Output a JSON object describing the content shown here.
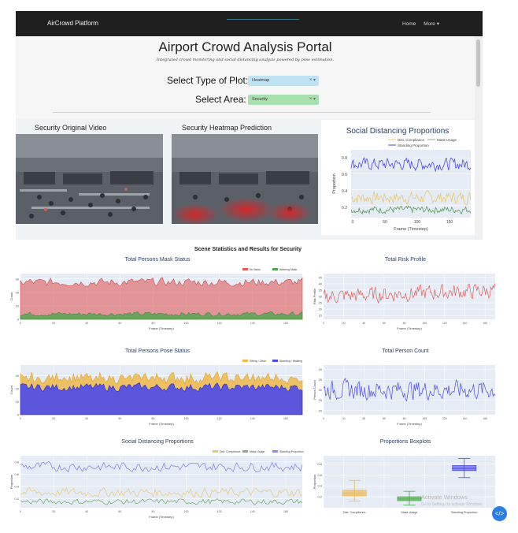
{
  "navbar": {
    "brand": "AirCrowd Platform",
    "links": [
      "Home",
      "More ▾"
    ]
  },
  "header": {
    "title": "Airport Crowd Analysis Portal",
    "subtitle": "Integrated crowd monitoring and social distancing analysis powered by pose estimation.",
    "plot_label": "Select Type of Plot:",
    "plot_value": "Heatmap",
    "area_label": "Select Area:",
    "area_value": "Security",
    "clear_glyph": "× ▾"
  },
  "videos": {
    "original_title": "Security Original Video",
    "heatmap_title": "Security Heatmap Prediction"
  },
  "colors": {
    "red": "#e05c5c",
    "green": "#4fa64f",
    "orange": "#f0b84a",
    "blue": "#4a4ae8",
    "yellow": "#e8c870",
    "grid": "#e5ecf6"
  },
  "section_heading": "Scene Statistics and Results for Security",
  "charts": {
    "top_sdp": {
      "title": "Social Distancing Proportions",
      "legend": [
        "Dist. Compliance",
        "Mask Usage",
        "Standing Proportion"
      ],
      "xlabel": "Frame (Timestep)",
      "ylabel": "Proportion",
      "xticks": [
        "0",
        "50",
        "100",
        "150"
      ],
      "yticks": [
        "0.2",
        "0.4",
        "0.6",
        "0.8"
      ]
    },
    "mask": {
      "title": "Total Persons Mask Status",
      "legend": [
        "No Mask",
        "Wearing Mask"
      ],
      "xlabel": "Frame (Timestep)",
      "ylabel": "Count"
    },
    "risk": {
      "title": "Total Risk Profile",
      "xlabel": "Frame (Timestep)",
      "ylabel": "Risk Profile"
    },
    "pose": {
      "title": "Total Persons Pose Status",
      "legend": [
        "Sitting / Other",
        "Standing / Walking"
      ],
      "xlabel": "Frame (Timestep)",
      "ylabel": "Count"
    },
    "count": {
      "title": "Total Person Count",
      "xlabel": "Frame (Timestep)",
      "ylabel": "Person Count"
    },
    "sdp": {
      "title": "Social Distancing Proportions",
      "legend": [
        "Dist. Compliance",
        "Mask Usage",
        "Standing Proportion"
      ],
      "xlabel": "Frame (Timestep)",
      "ylabel": "Proportion"
    },
    "box": {
      "title": "Proportions Boxplots",
      "categories": [
        "Dist. Compliance",
        "Mask Usage",
        "Standing Proportion"
      ],
      "ylabel": "Proportion"
    }
  },
  "chart_data": [
    {
      "type": "line",
      "title": "Social Distancing Proportions",
      "xlabel": "Frame (Timestep)",
      "ylabel": "Proportion",
      "xlim": [
        0,
        180
      ],
      "ylim": [
        0.05,
        0.9
      ],
      "series": [
        {
          "name": "Dist. Compliance",
          "mean": 0.3
        },
        {
          "name": "Mask Usage",
          "mean": 0.15
        },
        {
          "name": "Standing Proportion",
          "mean": 0.72
        }
      ]
    },
    {
      "type": "area",
      "title": "Total Persons Mask Status",
      "xlabel": "Frame (Timestep)",
      "ylabel": "Count",
      "yticks": [
        0,
        10,
        20,
        30
      ],
      "series": [
        {
          "name": "No Mask",
          "mean": 27
        },
        {
          "name": "Wearing Mask",
          "mean": 4
        }
      ]
    },
    {
      "type": "line",
      "title": "Total Risk Profile",
      "xlabel": "Frame (Timestep)",
      "ylabel": "Risk Profile",
      "yticks": [
        15,
        20,
        25,
        30,
        35,
        40,
        45
      ],
      "series": [
        {
          "name": "",
          "mean": 30
        }
      ]
    },
    {
      "type": "area",
      "title": "Total Persons Pose Status",
      "xlabel": "Frame (Timestep)",
      "ylabel": "Count",
      "yticks": [
        0,
        10,
        20,
        30
      ],
      "series": [
        {
          "name": "Sitting / Other",
          "mean": 29
        },
        {
          "name": "Standing / Walking",
          "mean": 21
        }
      ]
    },
    {
      "type": "line",
      "title": "Total Person Count",
      "xlabel": "Frame (Timestep)",
      "ylabel": "Person Count",
      "yticks": [
        20,
        25,
        30,
        35,
        40
      ],
      "series": [
        {
          "name": "",
          "mean": 30
        }
      ]
    },
    {
      "type": "box",
      "title": "Proportions Boxplots",
      "ylabel": "Proportion",
      "categories": [
        "Dist. Compliance",
        "Mask Usage",
        "Standing Proportion"
      ],
      "boxes": [
        {
          "min": 0.12,
          "q1": 0.22,
          "median": 0.27,
          "q3": 0.32,
          "max": 0.5
        },
        {
          "min": 0.05,
          "q1": 0.13,
          "median": 0.16,
          "q3": 0.2,
          "max": 0.3
        },
        {
          "min": 0.55,
          "q1": 0.68,
          "median": 0.72,
          "q3": 0.77,
          "max": 0.9
        }
      ]
    }
  ],
  "os": {
    "activate_title": "Activate Windows",
    "activate_sub": "Go to Settings to activate Windows."
  }
}
